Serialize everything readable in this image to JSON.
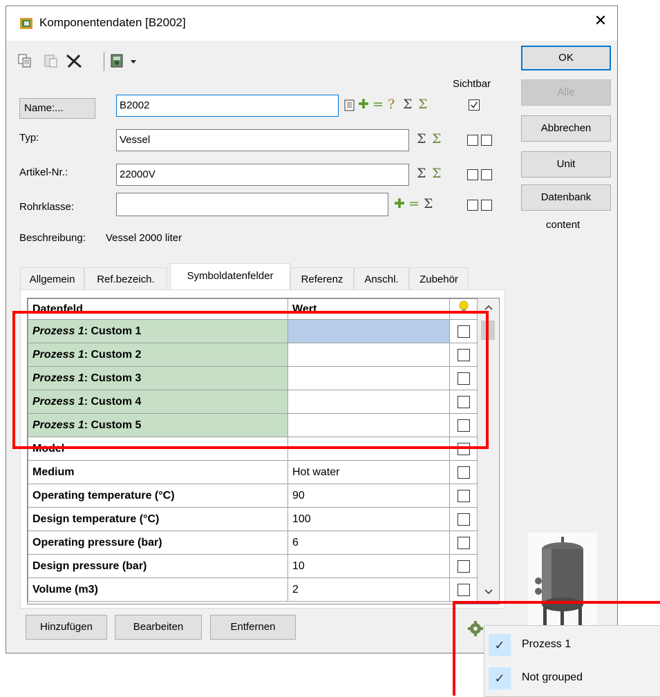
{
  "window": {
    "title": "Komponentendaten [B2002]",
    "close_label": "✕"
  },
  "buttons": {
    "ok": "OK",
    "alle": "Alle",
    "abbrechen": "Abbrechen",
    "unit": "Unit",
    "datenbank": "Datenbank",
    "content": "content"
  },
  "fields": {
    "name_label": "Name:...",
    "name_value": "B2002",
    "sichtbar_label": "Sichtbar",
    "typ_label": "Typ:",
    "typ_value": "Vessel",
    "artikel_label": "Artikel-Nr.:",
    "artikel_value": "22000V",
    "rohrklasse_label": "Rohrklasse:",
    "rohrklasse_value": "",
    "beschreibung_label": "Beschreibung:",
    "beschreibung_value": "Vessel 2000 liter"
  },
  "tabs": [
    "Allgemein",
    "Ref.bezeich.",
    "Symboldatenfelder",
    "Referenz",
    "Anschl.",
    "Zubehör"
  ],
  "grid": {
    "col_datenfeld": "Datenfeld",
    "col_wert": "Wert",
    "rows": [
      {
        "prefix": "Prozess 1",
        "name": ": Custom 1",
        "value": ""
      },
      {
        "prefix": "Prozess 1",
        "name": ": Custom 2",
        "value": ""
      },
      {
        "prefix": "Prozess 1",
        "name": ": Custom 3",
        "value": ""
      },
      {
        "prefix": "Prozess 1",
        "name": ": Custom 4",
        "value": ""
      },
      {
        "prefix": "Prozess 1",
        "name": ": Custom 5",
        "value": ""
      },
      {
        "prefix": "",
        "name": "Model",
        "value": ""
      },
      {
        "prefix": "",
        "name": "Medium",
        "value": "Hot water"
      },
      {
        "prefix": "",
        "name": "Operating temperature (°C)",
        "value": "90"
      },
      {
        "prefix": "",
        "name": "Design temperature (°C)",
        "value": "100"
      },
      {
        "prefix": "",
        "name": "Operating pressure (bar)",
        "value": "6"
      },
      {
        "prefix": "",
        "name": "Design pressure (bar)",
        "value": "10"
      },
      {
        "prefix": "",
        "name": "Volume (m3)",
        "value": "2"
      }
    ]
  },
  "bottom": {
    "hinzufuegen": "Hinzufügen",
    "bearbeiten": "Bearbeiten",
    "entfernen": "Entfernen"
  },
  "menu": {
    "items": [
      "Prozess 1",
      "Not grouped"
    ],
    "check": "✓"
  },
  "colors": {
    "accent": "#0078d7",
    "highlight": "#ff0000",
    "group_row": "#c6dfc6",
    "selected_cell": "#b7cdea"
  }
}
